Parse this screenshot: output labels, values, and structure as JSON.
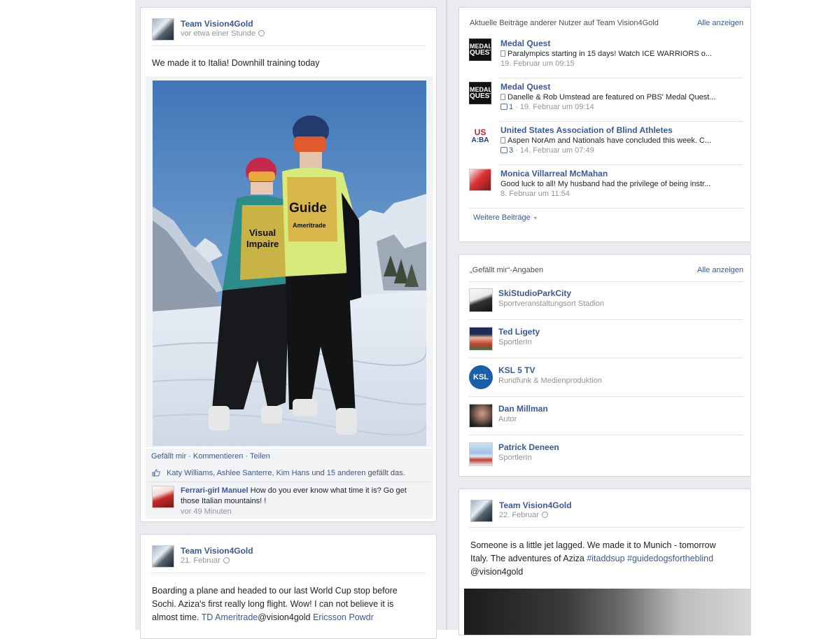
{
  "post1": {
    "author": "Team Vision4Gold",
    "time": "vor etwa einer Stunde",
    "text": "We made it to Italia! Downhill training today",
    "actions": "Gefällt mir · Kommentieren · Teilen",
    "likes_names": "Katy Williams, Ashlee Santerre, Kim Hans",
    "likes_and": "und",
    "likes_others": "15 anderen",
    "likes_suffix": "gefällt das.",
    "comment": {
      "author": "Ferrari-girl Manuel",
      "text": "How do you ever know what time it is? Go get those Italian mountains! !",
      "time": "vor 49 Minuten"
    },
    "photo_bib_left_line1": "Visual",
    "photo_bib_left_line2": "Impaire",
    "photo_bib_right_line1": "Guide",
    "photo_bib_right_line2": "Ameritrade"
  },
  "post2": {
    "author": "Team Vision4Gold",
    "time": "21. Februar",
    "text_line1": "Boarding a plane and headed to our last World Cup stop before",
    "text_line2": "Sochi. Aziza's first really long flight. Wow! I can not believe it is",
    "text_line3_pre": "almost time.",
    "text_link1": "TD Ameritrade",
    "text_mid": "@vision4gold",
    "text_link2": "Ericsson Powdr"
  },
  "recent_posts": {
    "title": "Aktuelle Beiträge anderer Nutzer auf Team Vision4Gold",
    "see_all": "Alle anzeigen",
    "more": "Weitere Beiträge",
    "items": [
      {
        "name": "Medal Quest",
        "text": "Paralympics starting in 15 days! Watch ICE WARRIORS o...",
        "likes": "",
        "date": "19. Februar um 09:15",
        "avatar_text_1": "MEDAL",
        "avatar_text_2": "QUEST"
      },
      {
        "name": "Medal Quest",
        "text": "Danelle & Rob Umstead are featured on PBS' Medal Quest...",
        "likes": "1",
        "date": "· 19. Februar um 09:14",
        "avatar_text_1": "MEDAL",
        "avatar_text_2": "QUEST"
      },
      {
        "name": "United States Association of Blind Athletes",
        "text": "Aspen NorAm and Nationals have concluded this week. C...",
        "likes": "3",
        "date": "· 14. Februar um 07:49",
        "avatar_text_1": "US",
        "avatar_text_2": "A:BA"
      },
      {
        "name": "Monica Villarreal McMahan",
        "text": "Good luck to all! My husband had the privilege of being instr...",
        "likes": "",
        "date": "8. Februar um 11:54",
        "avatar_text_1": "",
        "avatar_text_2": ""
      }
    ]
  },
  "likes_section": {
    "title": "„Gefällt mir“-Angaben",
    "see_all": "Alle anzeigen",
    "items": [
      {
        "name": "SkiStudioParkCity",
        "category": "Sportveranstaltungsort Stadion",
        "avatar_text": ""
      },
      {
        "name": "Ted Ligety",
        "category": "SportlerIn",
        "avatar_text": ""
      },
      {
        "name": "KSL 5 TV",
        "category": "Rundfunk & Medienproduktion",
        "avatar_text": "KSL"
      },
      {
        "name": "Dan Millman",
        "category": "Autor",
        "avatar_text": ""
      },
      {
        "name": "Patrick Deneen",
        "category": "SportlerIn",
        "avatar_text": ""
      }
    ]
  },
  "post3": {
    "author": "Team Vision4Gold",
    "time": "22. Februar",
    "text_line1": "Someone is a little jet lagged. We made it to Munich - tomorrow",
    "text_line2_pre": "Italy. The adventures of Aziza",
    "hashtag1": "#itaddsup",
    "hashtag2": "#guidedogsfortheblind",
    "text_line3": "@vision4gold"
  },
  "colors": {
    "link": "#3b5998",
    "timeline_bg": "#e9ebee",
    "sky": "#4a7cb5"
  }
}
